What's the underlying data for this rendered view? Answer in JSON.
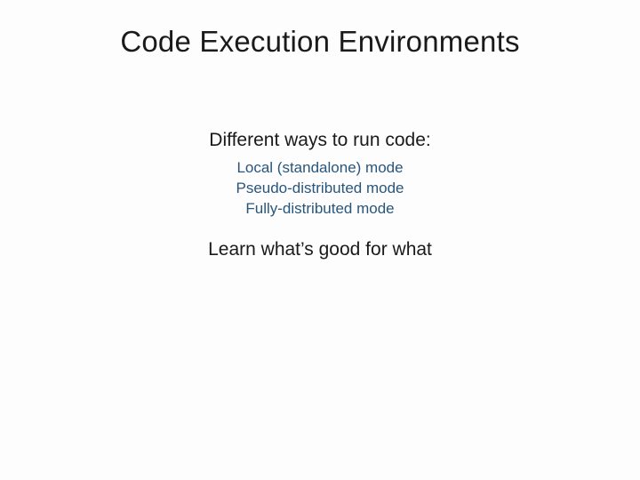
{
  "title": "Code Execution Environments",
  "subtitle": "Different ways to run code:",
  "items": [
    "Local (standalone) mode",
    "Pseudo-distributed mode",
    "Fully-distributed mode"
  ],
  "footer": "Learn what’s good for what"
}
